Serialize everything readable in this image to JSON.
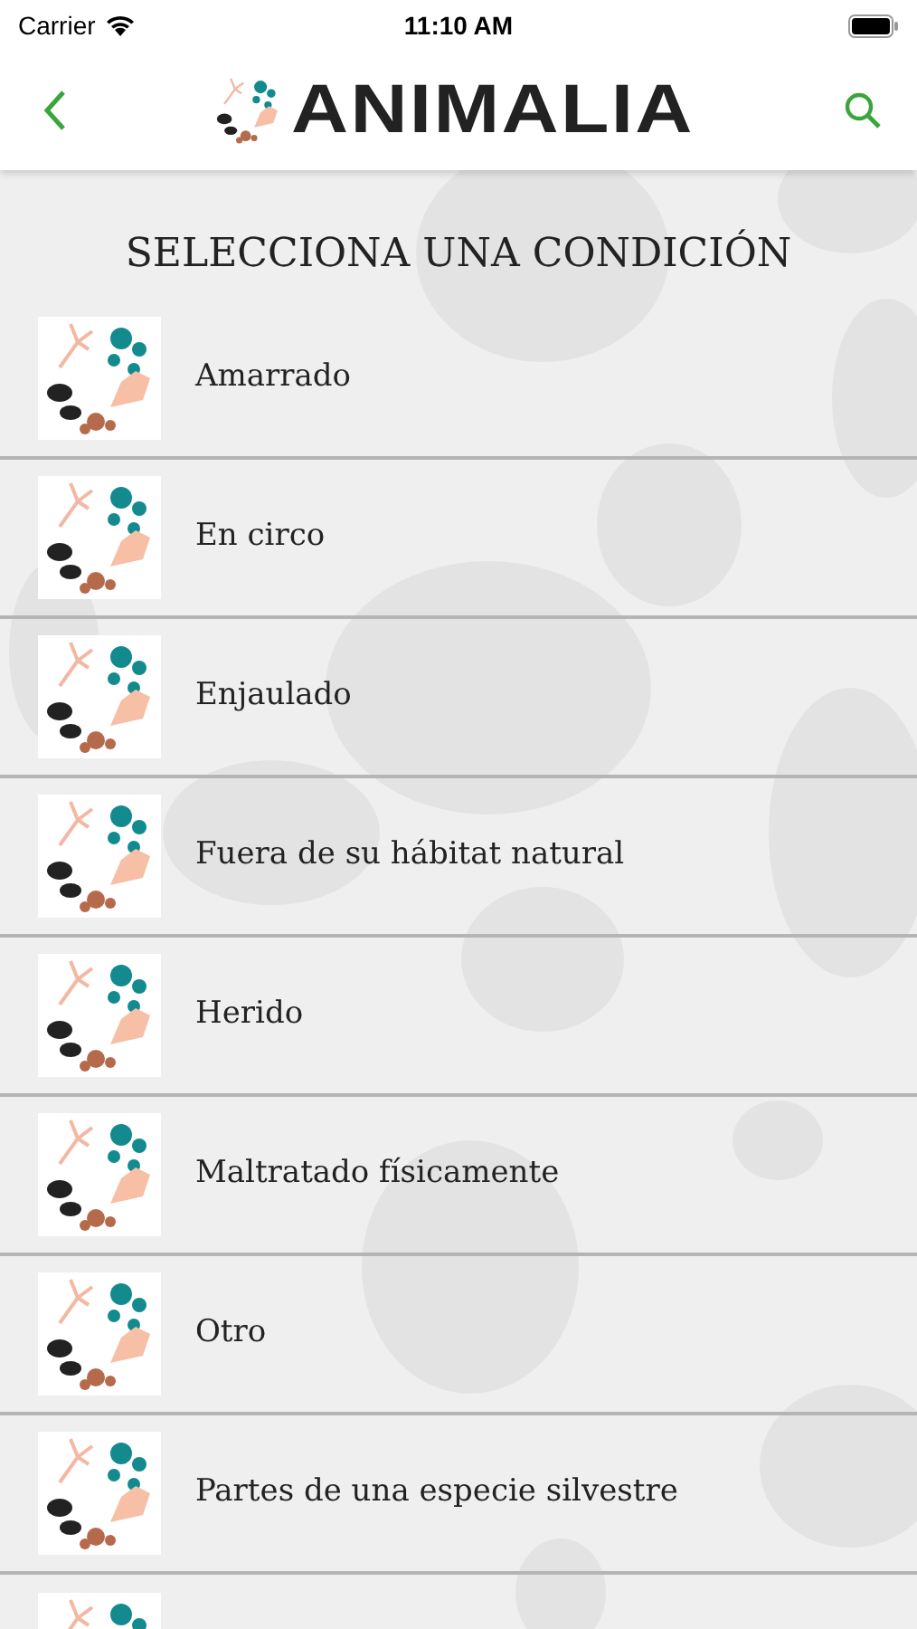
{
  "status_bar": {
    "carrier": "Carrier",
    "time": "11:10 AM"
  },
  "nav_bar": {
    "logo_text": "ANIMALIA"
  },
  "heading": "SELECCIONA UNA CONDICIÓN",
  "conditions": [
    {
      "kind": "row",
      "label": "Amarrado"
    },
    {
      "kind": "row",
      "label": "En circo"
    },
    {
      "kind": "row",
      "label": "Enjaulado"
    },
    {
      "kind": "row",
      "label": "Fuera de su hábitat natural"
    },
    {
      "kind": "row",
      "label": "Herido"
    },
    {
      "kind": "row",
      "label": "Maltratado físicamente"
    },
    {
      "kind": "row",
      "label": "Otro"
    },
    {
      "kind": "row",
      "label": "Partes de una especie silvestre"
    },
    {
      "kind": "cut"
    }
  ]
}
